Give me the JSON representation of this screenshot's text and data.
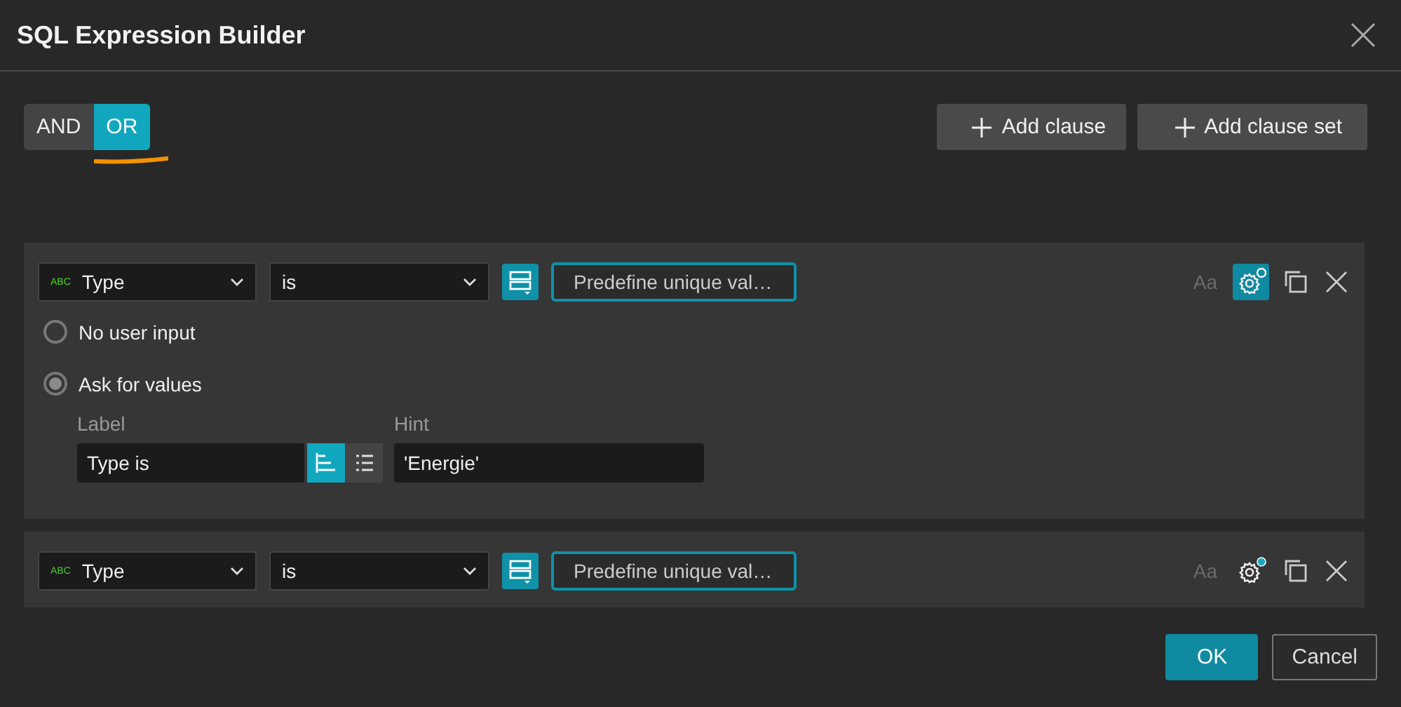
{
  "window": {
    "title": "SQL Expression Builder"
  },
  "logic": [
    {
      "label": "AND",
      "selected": false
    },
    {
      "label": "OR",
      "selected": true
    }
  ],
  "annotation": {
    "kind": "underline"
  },
  "actions": [
    {
      "label": "Add clause"
    },
    {
      "label": "Add clause set"
    }
  ],
  "clauses": [
    {
      "field_type": "ABC",
      "field": "Type",
      "operator": "is",
      "value": "Predefine unique val…",
      "case_label": "Aa",
      "settings_active": true,
      "input_options": [
        {
          "label": "No user input",
          "selected": false
        },
        {
          "label": "Ask for values",
          "selected": true
        }
      ],
      "label_field": {
        "caption": "Label",
        "value": "Type is"
      },
      "layouts": [
        {
          "selected": true
        },
        {
          "selected": false
        }
      ],
      "hint_field": {
        "caption": "Hint",
        "value": "'Energie'"
      }
    },
    {
      "field_type": "ABC",
      "field": "Type",
      "operator": "is",
      "value": "Predefine unique val…",
      "case_label": "Aa",
      "settings_active": false
    }
  ],
  "buttons": [
    {
      "label": "OK",
      "kind": "primary"
    },
    {
      "label": "Cancel",
      "kind": "secondary"
    }
  ]
}
